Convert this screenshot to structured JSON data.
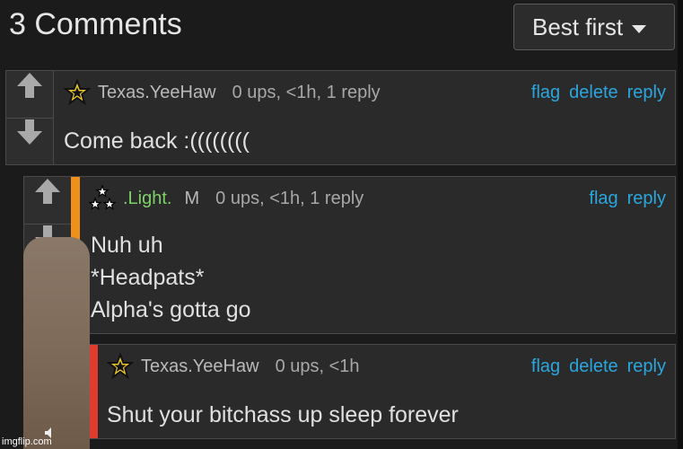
{
  "header": {
    "title": "3 Comments",
    "sort_label": "Best first"
  },
  "comments": [
    {
      "user": "Texas.YeeHaw",
      "stats": "0 ups, <1h, 1 reply",
      "actions": [
        "flag",
        "delete",
        "reply"
      ],
      "body": [
        "Come back :(((((((("
      ],
      "icon": "star-icon"
    },
    {
      "user": ".Light.",
      "user_color": "#7fd06a",
      "badge": "M",
      "stats": "0 ups, <1h, 1 reply",
      "actions": [
        "flag",
        "reply"
      ],
      "body": [
        "Nuh uh",
        "*Headpats*",
        "Alpha's gotta go"
      ],
      "bar_color": "#f0901a",
      "icon": "three-stars-icon"
    },
    {
      "user": "Texas.YeeHaw",
      "stats": "0 ups, <1h",
      "actions": [
        "flag",
        "delete",
        "reply"
      ],
      "body": [
        "Shut your bitchass up sleep forever"
      ],
      "bar_color": "#e03b2e",
      "icon": "star-icon"
    }
  ],
  "watermark": "imgflip.com",
  "colors": {
    "link": "#2ba6de",
    "background": "#1b1b1b",
    "panel": "#2a2a2a"
  }
}
